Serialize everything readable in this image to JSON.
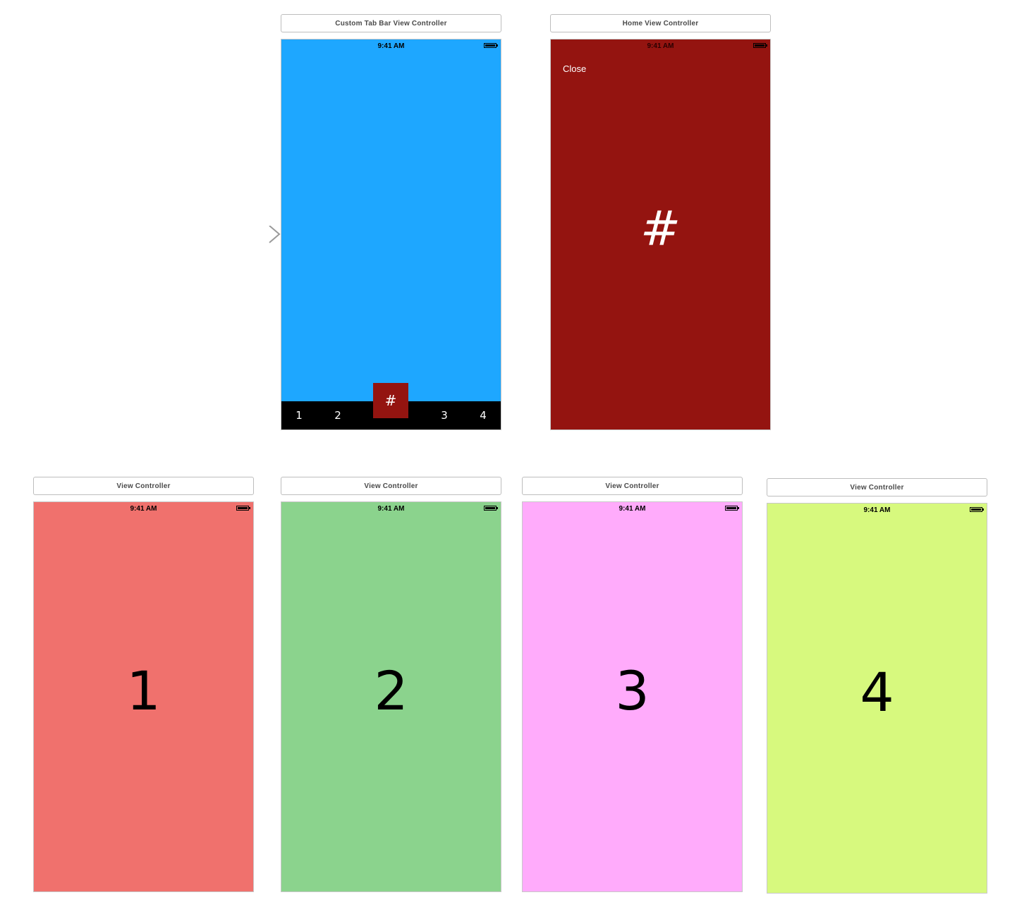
{
  "colors": {
    "tab_bar_bg": "#1EA7FF",
    "home_bg": "#941410",
    "vc1_bg": "#F0716D",
    "vc2_bg": "#8BD38D",
    "vc3_bg": "#FFABFB",
    "vc4_bg": "#D7F97E",
    "center_tab_bg": "#941410"
  },
  "tab_bar_scene": {
    "title": "Custom Tab Bar View Controller",
    "status_time": "9:41 AM",
    "tabs": [
      "1",
      "2",
      "3",
      "4"
    ],
    "center_tab_label": "#"
  },
  "home_scene": {
    "title": "Home View Controller",
    "status_time": "9:41 AM",
    "close_label": "Close",
    "center_symbol": "#"
  },
  "view_controllers": [
    {
      "title": "View Controller",
      "status_time": "9:41 AM",
      "number": "1"
    },
    {
      "title": "View Controller",
      "status_time": "9:41 AM",
      "number": "2"
    },
    {
      "title": "View Controller",
      "status_time": "9:41 AM",
      "number": "3"
    },
    {
      "title": "View Controller",
      "status_time": "9:41 AM",
      "number": "4"
    }
  ],
  "icons": {
    "entry_point": "arrow-right-icon",
    "battery": "battery-icon"
  }
}
